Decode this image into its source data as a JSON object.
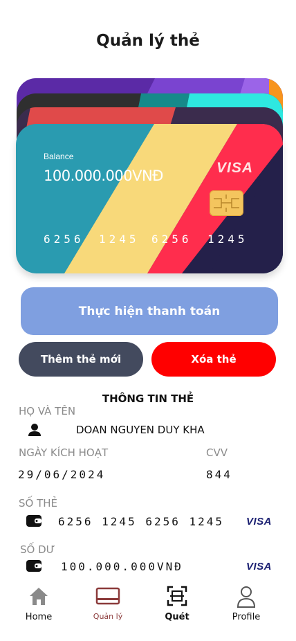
{
  "page": {
    "title": "Quản lý thẻ"
  },
  "card": {
    "balance_label": "Balance",
    "balance_value": "100.000.000VNĐ",
    "brand": "VISA",
    "number_groups": [
      "6256",
      "1245",
      "6256",
      "1245"
    ]
  },
  "actions": {
    "pay_label": "Thực hiện thanh toán",
    "add_label": "Thêm thẻ mới",
    "delete_label": "Xóa thẻ"
  },
  "info": {
    "section_title": "THÔNG TIN THẺ",
    "name_label": "HỌ VÀ TÊN",
    "name_value": "DOAN NGUYEN DUY KHA",
    "activation_label": "NGÀY KÍCH HOẠT",
    "activation_value": "29/06/2024",
    "cvv_label": "CVV",
    "cvv_value": "844",
    "number_label": "SỐ THẺ",
    "number_value": "6256 1245 6256 1245",
    "balance_label": "SỐ DƯ",
    "balance_value": "100.000.000VNĐ",
    "brand": "VISA"
  },
  "nav": {
    "items": [
      {
        "label": "Home",
        "icon": "home-icon",
        "active": false
      },
      {
        "label": "Quản lý",
        "icon": "card-icon",
        "active": true
      },
      {
        "label": "Quét",
        "icon": "scan-icon",
        "active": false
      },
      {
        "label": "Profile",
        "icon": "user-icon",
        "active": false
      }
    ]
  },
  "colors": {
    "pay_button": "#7f9fe0",
    "add_button": "#434a5e",
    "delete_button": "#ff0000",
    "nav_active": "#8b3a3a"
  }
}
